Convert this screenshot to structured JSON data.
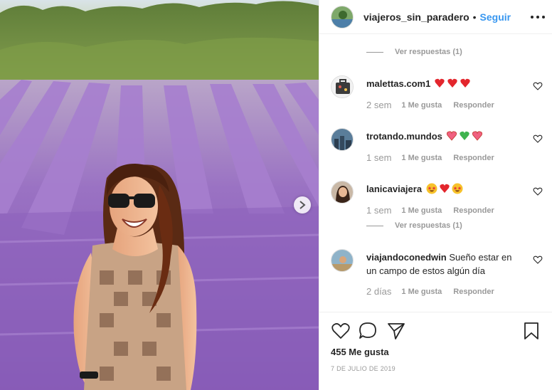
{
  "header": {
    "username": "viajeros_sin_paradero",
    "separator": "•",
    "follow_label": "Seguir"
  },
  "comments": {
    "view_replies_1": "Ver respuestas (1)",
    "view_replies_2": "Ver respuestas (1)",
    "items": [
      {
        "user": "malettas.com1",
        "text": "",
        "emoji": [
          "heart",
          "heart",
          "heart"
        ],
        "time": "2 sem",
        "likes": "1 Me gusta",
        "reply": "Responder"
      },
      {
        "user": "trotando.mundos",
        "text": "",
        "emoji": [
          "pink-heart",
          "green-heart",
          "pink-heart"
        ],
        "time": "1 sem",
        "likes": "1 Me gusta",
        "reply": "Responder"
      },
      {
        "user": "lanicaviajera",
        "text": "",
        "emoji": [
          "star-eyes",
          "heart",
          "star-eyes"
        ],
        "time": "1 sem",
        "likes": "1 Me gusta",
        "reply": "Responder"
      },
      {
        "user": "viajandoconedwin",
        "text": "Sueño estar en un campo de estos algún día",
        "emoji": [],
        "time": "2 días",
        "likes": "1 Me gusta",
        "reply": "Responder"
      }
    ]
  },
  "footer": {
    "likes_count": "455 Me gusta",
    "date": "7 DE JULIO DE 2019"
  },
  "colors": {
    "accent": "#3897f0",
    "text": "#262626",
    "muted": "#999999",
    "heart": "#ed1c24",
    "green_heart": "#3fb34f"
  }
}
